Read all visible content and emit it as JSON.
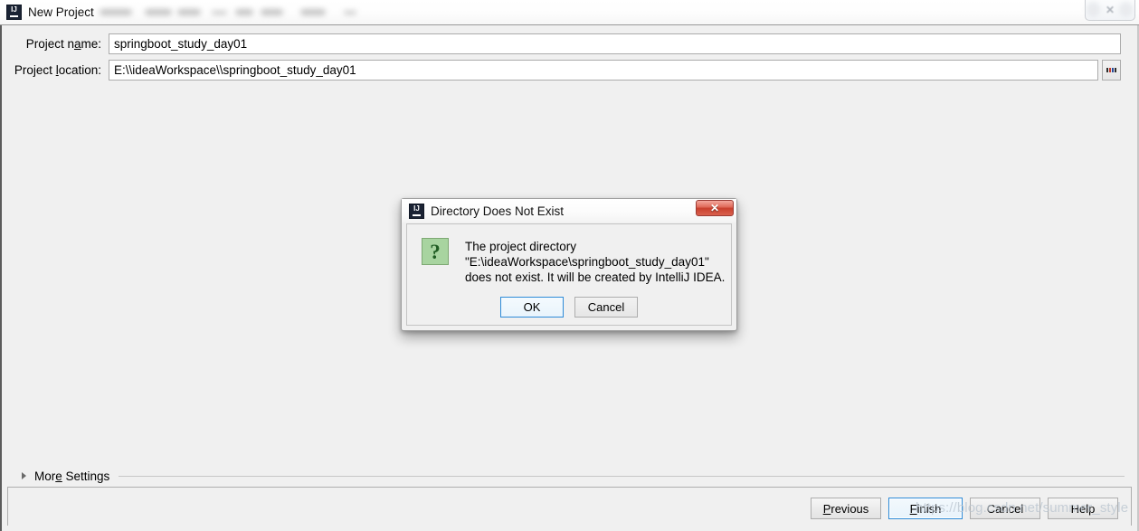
{
  "window": {
    "title": "New Project",
    "app_icon": "intellij-idea-icon",
    "close_label": "✕"
  },
  "form": {
    "project_name": {
      "label_before": "Project n",
      "label_mnemonic": "a",
      "label_after": "me:",
      "value": "springboot_study_day01"
    },
    "project_location": {
      "label_before": "Project ",
      "label_mnemonic": "l",
      "label_after": "ocation:",
      "value": "E:\\\\ideaWorkspace\\\\springboot_study_day01"
    },
    "browse_button_label": "..."
  },
  "more_settings": {
    "label_before": "Mor",
    "label_mnemonic": "e",
    "label_after": " Settings",
    "expanded": false
  },
  "footer": {
    "buttons": [
      {
        "before": "",
        "mnemonic": "P",
        "after": "revious",
        "default": false,
        "name": "previous-button"
      },
      {
        "before": "",
        "mnemonic": "F",
        "after": "inish",
        "default": true,
        "name": "finish-button"
      },
      {
        "before": "Cancel",
        "mnemonic": "",
        "after": "",
        "default": false,
        "name": "cancel-button"
      },
      {
        "before": "Help",
        "mnemonic": "",
        "after": "",
        "default": false,
        "name": "help-button"
      }
    ]
  },
  "watermark": {
    "text": "https://blog.csdn.net/summer_style"
  },
  "dialog": {
    "title": "Directory Does Not Exist",
    "icon": "question-icon",
    "close_label": "✕",
    "message_lines": [
      "The project directory",
      "\"E:\\ideaWorkspace\\springboot_study_day01\"",
      "does not exist. It will be created by IntelliJ IDEA."
    ],
    "ok_label": "OK",
    "cancel_label": "Cancel"
  },
  "colors": {
    "accent_blue": "#2e8bd8",
    "dialog_close_red": "#c9402e",
    "question_green": "#a8d4a0",
    "panel_bg": "#f0f0f0",
    "ij_logo_navy": "#1b2334"
  }
}
